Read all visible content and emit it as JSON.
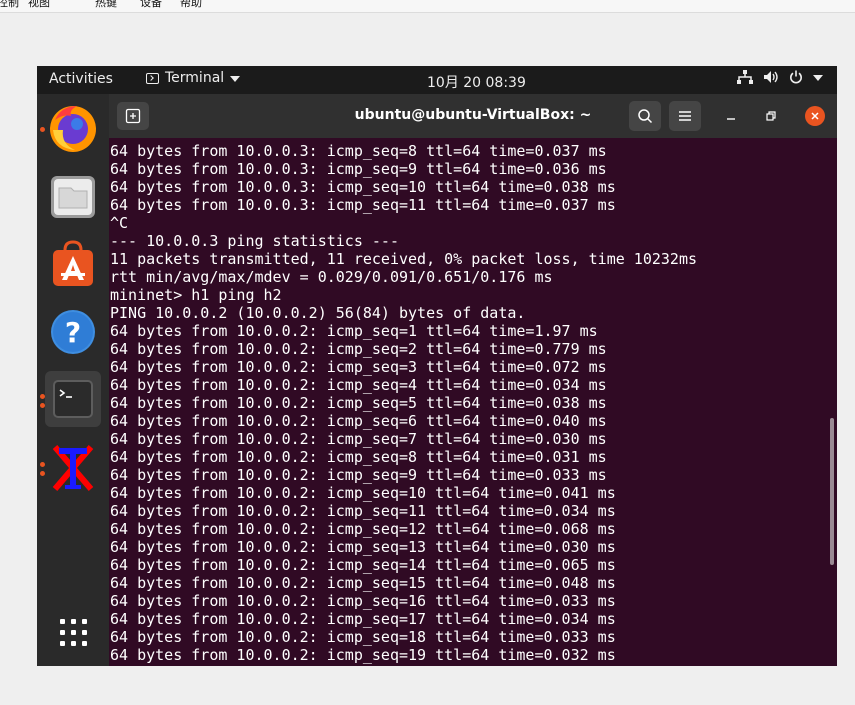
{
  "host_menu": [
    "控制",
    "视图",
    "热键",
    "设备",
    "帮助"
  ],
  "topbar": {
    "activities": "Activities",
    "app_name": "Terminal",
    "clock": "10月 20  08:39"
  },
  "dock": {
    "items": [
      {
        "name": "firefox",
        "running": true
      },
      {
        "name": "files",
        "running": false
      },
      {
        "name": "software",
        "running": false
      },
      {
        "name": "help",
        "running": false
      },
      {
        "name": "terminal",
        "running": true,
        "active": true
      },
      {
        "name": "xterm",
        "running": true
      }
    ],
    "apps_grid": "show-applications"
  },
  "terminal": {
    "title": "ubuntu@ubuntu-VirtualBox: ~",
    "lines": [
      "64 bytes from 10.0.0.3: icmp_seq=8 ttl=64 time=0.037 ms",
      "64 bytes from 10.0.0.3: icmp_seq=9 ttl=64 time=0.036 ms",
      "64 bytes from 10.0.0.3: icmp_seq=10 ttl=64 time=0.038 ms",
      "64 bytes from 10.0.0.3: icmp_seq=11 ttl=64 time=0.037 ms",
      "^C",
      "--- 10.0.0.3 ping statistics ---",
      "11 packets transmitted, 11 received, 0% packet loss, time 10232ms",
      "rtt min/avg/max/mdev = 0.029/0.091/0.651/0.176 ms",
      "mininet> h1 ping h2",
      "PING 10.0.0.2 (10.0.0.2) 56(84) bytes of data.",
      "64 bytes from 10.0.0.2: icmp_seq=1 ttl=64 time=1.97 ms",
      "64 bytes from 10.0.0.2: icmp_seq=2 ttl=64 time=0.779 ms",
      "64 bytes from 10.0.0.2: icmp_seq=3 ttl=64 time=0.072 ms",
      "64 bytes from 10.0.0.2: icmp_seq=4 ttl=64 time=0.034 ms",
      "64 bytes from 10.0.0.2: icmp_seq=5 ttl=64 time=0.038 ms",
      "64 bytes from 10.0.0.2: icmp_seq=6 ttl=64 time=0.040 ms",
      "64 bytes from 10.0.0.2: icmp_seq=7 ttl=64 time=0.030 ms",
      "64 bytes from 10.0.0.2: icmp_seq=8 ttl=64 time=0.031 ms",
      "64 bytes from 10.0.0.2: icmp_seq=9 ttl=64 time=0.033 ms",
      "64 bytes from 10.0.0.2: icmp_seq=10 ttl=64 time=0.041 ms",
      "64 bytes from 10.0.0.2: icmp_seq=11 ttl=64 time=0.034 ms",
      "64 bytes from 10.0.0.2: icmp_seq=12 ttl=64 time=0.068 ms",
      "64 bytes from 10.0.0.2: icmp_seq=13 ttl=64 time=0.030 ms",
      "64 bytes from 10.0.0.2: icmp_seq=14 ttl=64 time=0.065 ms",
      "64 bytes from 10.0.0.2: icmp_seq=15 ttl=64 time=0.048 ms",
      "64 bytes from 10.0.0.2: icmp_seq=16 ttl=64 time=0.033 ms",
      "64 bytes from 10.0.0.2: icmp_seq=17 ttl=64 time=0.034 ms",
      "64 bytes from 10.0.0.2: icmp_seq=18 ttl=64 time=0.033 ms",
      "64 bytes from 10.0.0.2: icmp_seq=19 ttl=64 time=0.032 ms"
    ]
  },
  "colors": {
    "terminal_bg": "#300a24",
    "accent": "#e95420",
    "topbar_bg": "#1b1b1b",
    "headerbar_bg": "#303030"
  }
}
